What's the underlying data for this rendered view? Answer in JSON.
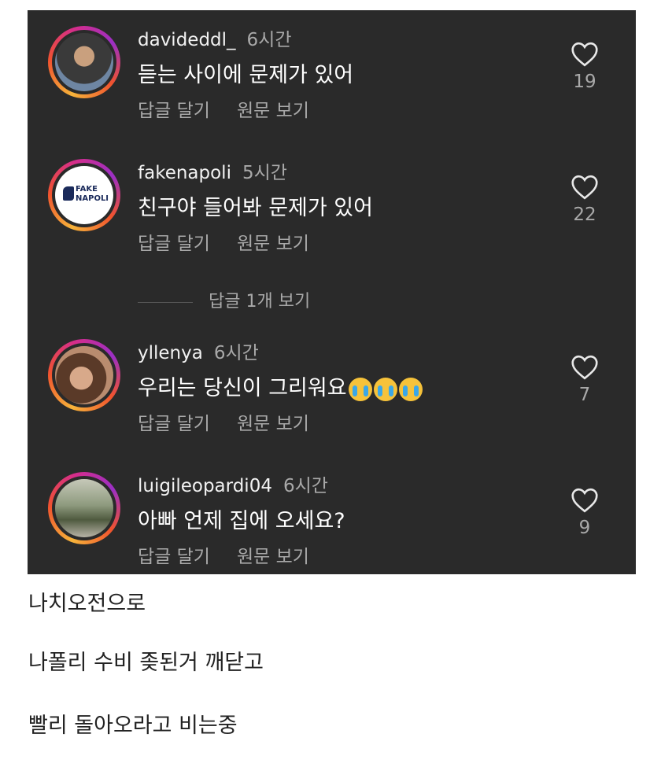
{
  "comments": [
    {
      "username": "davideddl_",
      "time": "6시간",
      "text": "듣는 사이에 문제가 있어",
      "reply": "답글 달기",
      "view_original": "원문 보기",
      "likes": "19"
    },
    {
      "username": "fakenapoli",
      "time": "5시간",
      "text": "친구야 들어봐 문제가 있어",
      "reply": "답글 달기",
      "view_original": "원문 보기",
      "likes": "22",
      "logo_line1": "FAKE",
      "logo_line2": "NAPOLI"
    },
    {
      "username": "yllenya",
      "time": "6시간",
      "text": "우리는 당신이 그리워요",
      "emoji": "loudly-crying-face",
      "emoji_count": 3,
      "reply": "답글 달기",
      "view_original": "원문 보기",
      "likes": "7"
    },
    {
      "username": "luigileopardi04",
      "time": "6시간",
      "text": "아빠 언제 집에 오세요?",
      "reply": "답글 달기",
      "view_original": "원문 보기",
      "likes": "9"
    }
  ],
  "view_replies": "답글 1개 보기",
  "caption_lines": [
    "나치오전으로",
    "나폴리 수비 좆된거 깨닫고",
    "빨리 돌아오라고 비는중"
  ],
  "colors": {
    "panel_bg": "#2a2a2a",
    "muted_text": "#a9a9a9"
  },
  "icons": {
    "like": "heart-outline-icon"
  }
}
